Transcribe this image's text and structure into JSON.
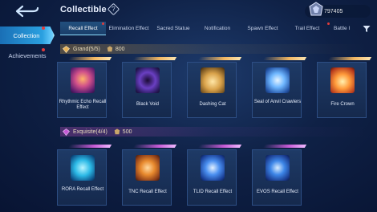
{
  "header": {
    "title": "Collectible",
    "currency_value": "797405"
  },
  "sidebar": {
    "items": [
      {
        "label": "Collection",
        "active": true
      },
      {
        "label": "Achievements",
        "active": false
      }
    ]
  },
  "tabs": [
    {
      "label": "Recall Effect",
      "active": true
    },
    {
      "label": "Elimination Effect",
      "active": false
    },
    {
      "label": "Sacred Statue",
      "active": false
    },
    {
      "label": "Notification",
      "active": false
    },
    {
      "label": "Spawn Effect",
      "active": false
    },
    {
      "label": "Trail Effect",
      "active": false
    },
    {
      "label": "Battle I",
      "active": false
    }
  ],
  "sections": {
    "grand": {
      "label": "Grand(5/5)",
      "points": "800",
      "items": [
        {
          "name": "Rhythmic Echo Recall Effect"
        },
        {
          "name": "Black Void"
        },
        {
          "name": "Dashing Cat"
        },
        {
          "name": "Seal of Anvil Crawlers"
        },
        {
          "name": "Fire Crown"
        }
      ]
    },
    "exquisite": {
      "label": "Exquisite(4/4)",
      "points": "500",
      "items": [
        {
          "name": "RORA Recall Effect"
        },
        {
          "name": "TNC Recall Effect"
        },
        {
          "name": "TLID Recall Effect"
        },
        {
          "name": "EVOS Recall Effect"
        }
      ]
    }
  },
  "colors": {
    "accent_blue": "#2aa0e0",
    "gold": "#f1b662",
    "purple": "#c65bd6",
    "notification_dot": "#e23b3b"
  }
}
